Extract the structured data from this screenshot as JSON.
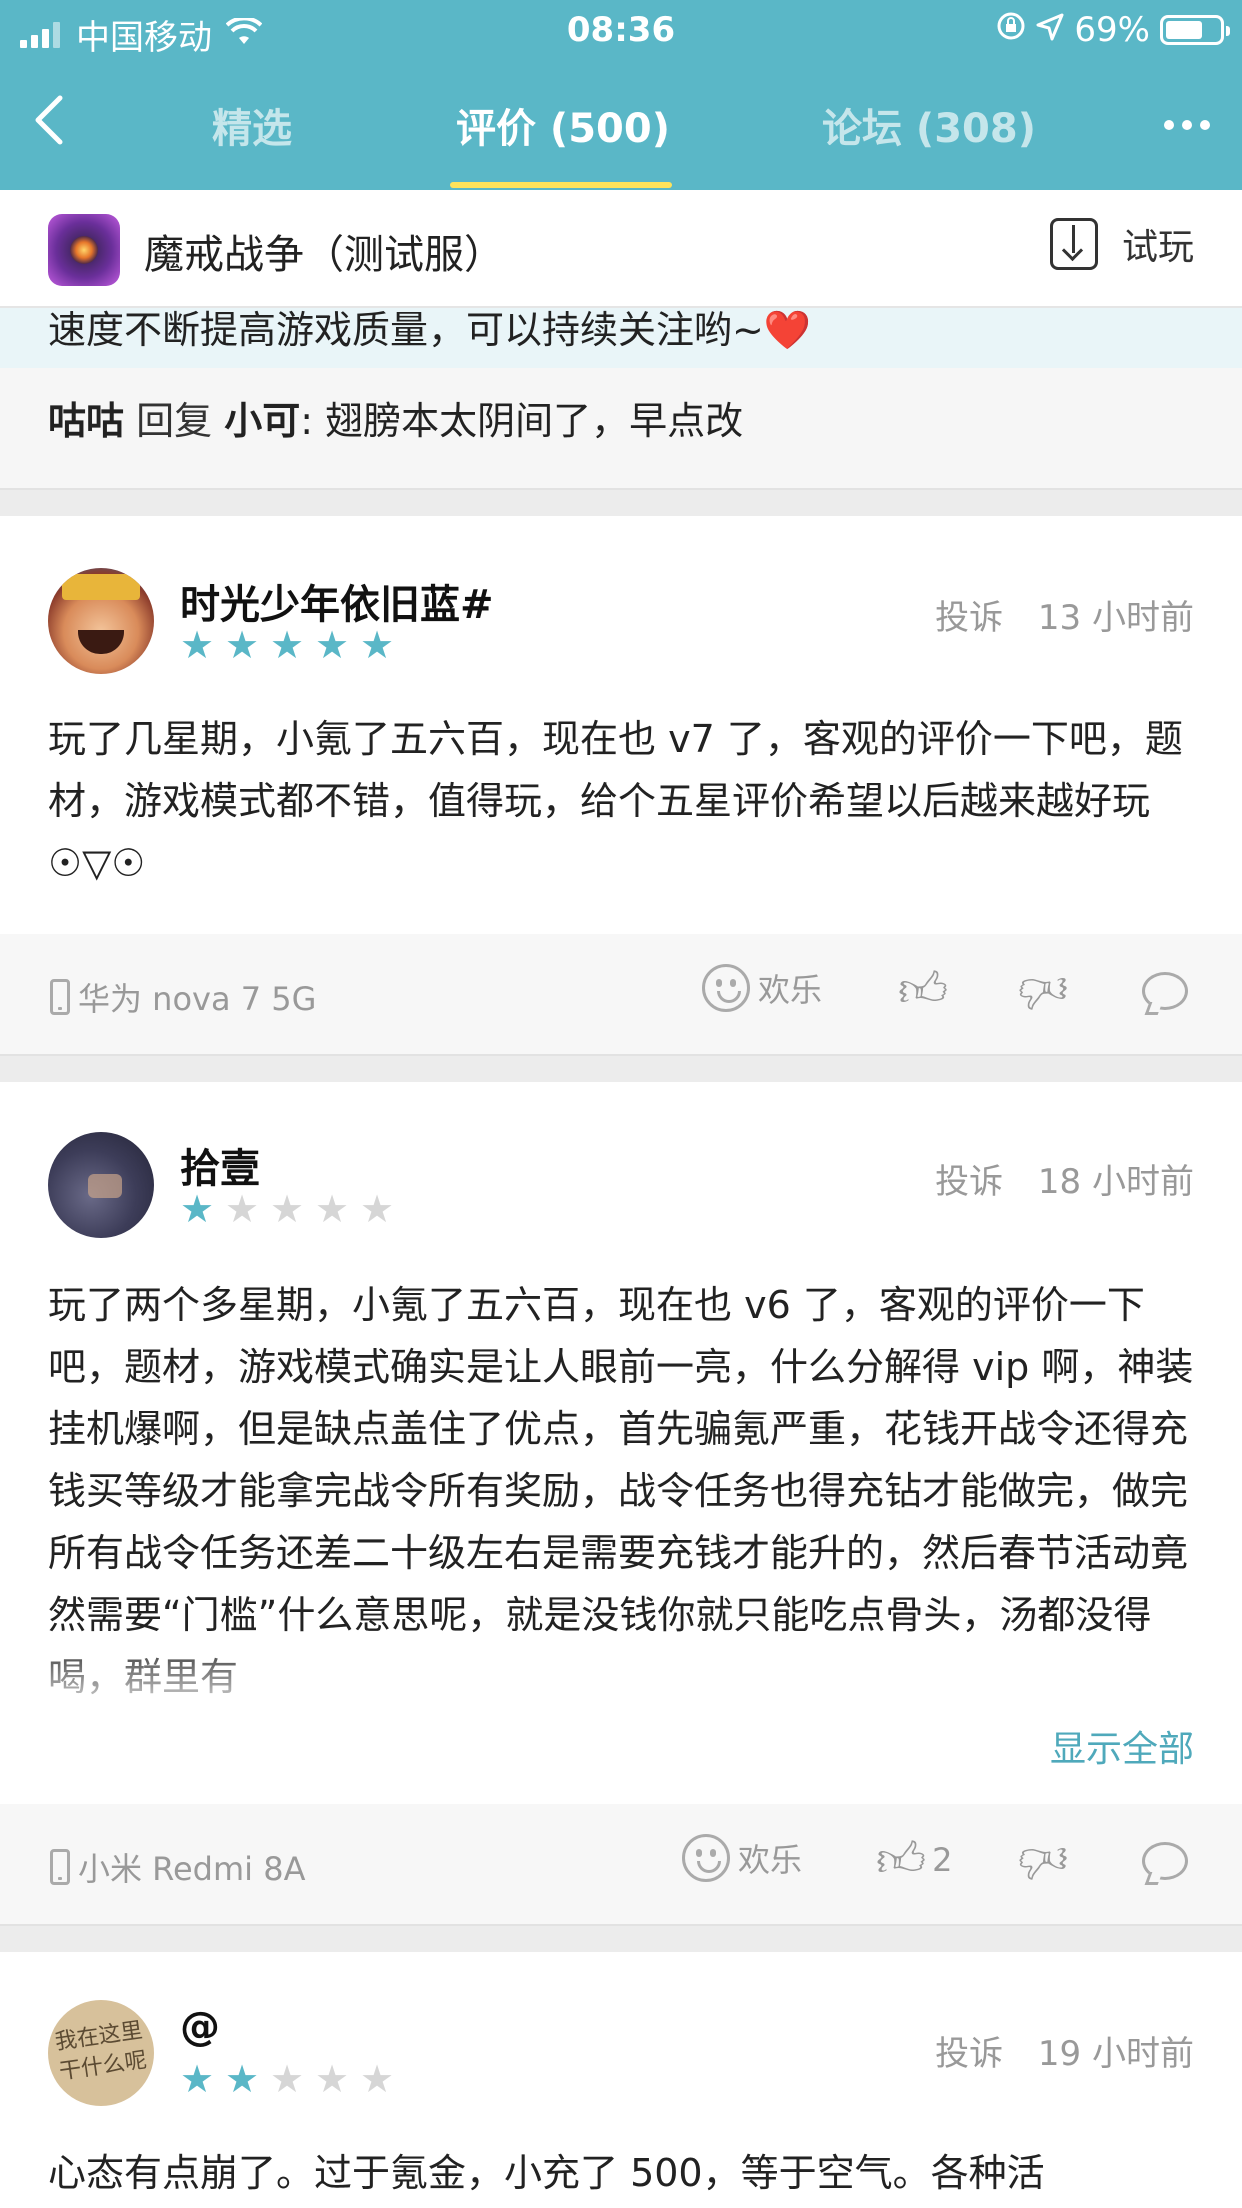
{
  "status_bar": {
    "carrier": "中国移动",
    "time": "08:36",
    "battery": "69%"
  },
  "nav": {
    "tabs": [
      {
        "label": "精选"
      },
      {
        "label": "评价 (500)"
      },
      {
        "label": "论坛 (308)"
      }
    ],
    "active_tab": 1
  },
  "app": {
    "name": "魔戒战争（测试服）",
    "try_label": "试玩"
  },
  "reply_snippet": {
    "top_text": "速度不断提高游戏质量，可以持续关注哟~❤️",
    "from_user": "咕咕",
    "reply_word": "回复",
    "to_user": "小可",
    "text": ": 翅膀本太阴间了，早点改"
  },
  "reviews": [
    {
      "username": "时光少年依旧蓝#",
      "rating": 5,
      "report_label": "投诉",
      "time": "13 小时前",
      "content": "玩了几星期，小氪了五六百，现在也 v7 了，客观的评价一下吧，题材，游戏模式都不错，值得玩，给个五星评价希望以后越来越好玩 ☉▽☉",
      "device": "华为 nova 7 5G",
      "mood": "欢乐",
      "likes": ""
    },
    {
      "username": "拾壹",
      "rating": 1,
      "report_label": "投诉",
      "time": "18 小时前",
      "content": "玩了两个多星期，小氪了五六百，现在也 v6 了，客观的评价一下吧，题材，游戏模式确实是让人眼前一亮，什么分解得 vip 啊，神装挂机爆啊，但是缺点盖住了优点，首先骗氪严重，花钱开战令还得充钱买等级才能拿完战令所有奖励，战令任务也得充钻才能做完，做完所有战令任务还差二十级左右是需要充钱才能升的，然后春节活动竟然需要“门槛”什么意思呢，就是没钱你就只能吃点骨头，汤都没得喝，群里有",
      "show_all": "显示全部",
      "device": "小米 Redmi 8A",
      "mood": "欢乐",
      "likes": "2"
    },
    {
      "username": "@",
      "rating": 2,
      "report_label": "投诉",
      "time": "19 小时前",
      "avatar_text": "我在这里干什么呢",
      "content": "心态有点崩了。过于氪金，小充了 500，等于空气。各种活"
    }
  ],
  "colors": {
    "header_bg": "#5ab7c7",
    "tab_indicator": "#ffe35a",
    "star_on": "#5ab7c7",
    "link": "#4fa9bb"
  }
}
